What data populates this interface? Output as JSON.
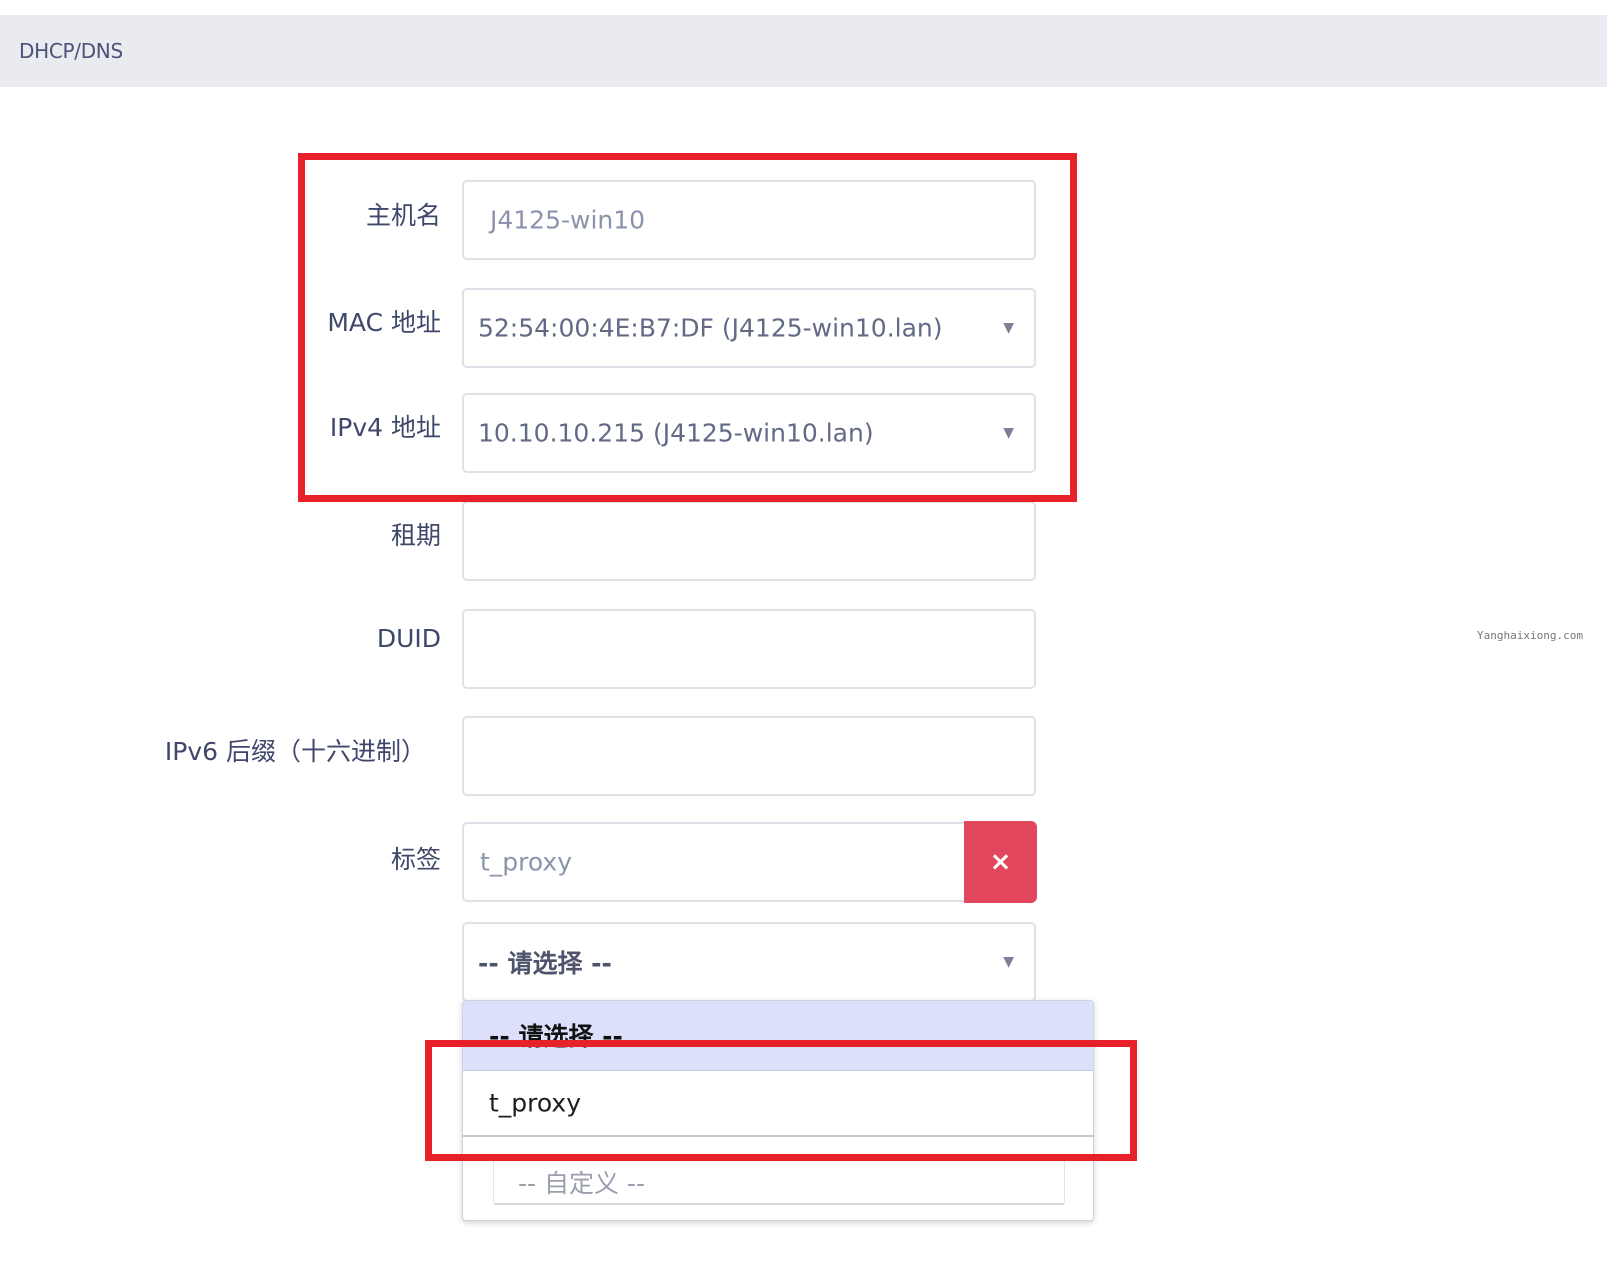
{
  "header": {
    "title": "DHCP/DNS"
  },
  "form": {
    "hostname": {
      "label": "主机名",
      "placeholder": "J4125-win10"
    },
    "mac": {
      "label": "MAC 地址",
      "value": "52:54:00:4E:B7:DF (J4125-win10.lan)"
    },
    "ipv4": {
      "label": "IPv4 地址",
      "value": "10.10.10.215 (J4125-win10.lan)"
    },
    "lease": {
      "label": "租期",
      "value": ""
    },
    "duid": {
      "label": "DUID",
      "value": ""
    },
    "ipv6_suffix": {
      "label": "IPv6 后缀（十六进制）",
      "value": ""
    },
    "tag": {
      "label": "标签",
      "value": "t_proxy",
      "remove_label": "×"
    },
    "tag_select": {
      "value": "-- 请选择 --"
    }
  },
  "dropdown": {
    "options": [
      "-- 请选择 --",
      "t_proxy"
    ],
    "custom_placeholder": "-- 自定义 --"
  },
  "watermark": "Yanghaixiong.com",
  "colors": {
    "highlight": "#e8202a",
    "remove_button": "#e2475e",
    "header_bg": "#e9ebf0"
  }
}
